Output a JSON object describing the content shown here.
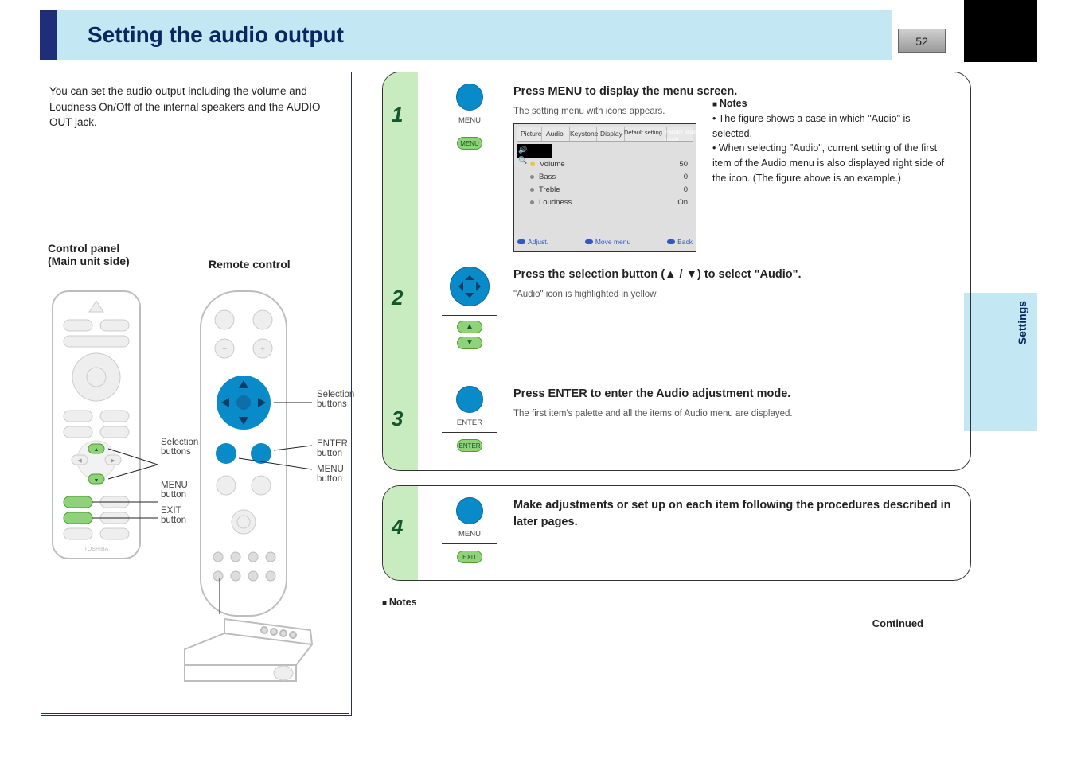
{
  "page": {
    "number": "52",
    "title": "Setting the audio output",
    "side_tab": "Settings"
  },
  "intro": "You can set the audio output including the volume and Loudness On/Off of the internal speakers and the AUDIO OUT jack.",
  "remote": {
    "title_left": "Control panel\n(Main unit side)",
    "title_right": "Remote control",
    "callouts": {
      "selection": "Selection\nbuttons",
      "menu_cp": "MENU\nbutton",
      "exit_cp": "EXIT\nbutton",
      "selection_rc": "Selection\nbuttons",
      "enter_rc": "ENTER\nbutton",
      "menu_rc": "MENU\nbutton"
    }
  },
  "icons": {
    "menu": "MENU",
    "enter": "ENTER",
    "exit": "EXIT"
  },
  "steps": [
    {
      "n": "1",
      "text": "Press MENU to display the menu screen.",
      "sub": "The setting menu with icons appears.",
      "icon_label_top": "MENU",
      "icon_label_bot": "MENU"
    },
    {
      "n": "2",
      "text_pre": "Press the selection button (",
      "text_mid": " / ",
      "text_post": ") to select \"Audio\".",
      "sub": "\"Audio\" icon is highlighted in yellow."
    },
    {
      "n": "3",
      "text": "Press ENTER to enter the Audio adjustment mode.",
      "sub": "The first item's palette and all the items of Audio menu are displayed.",
      "icon_label_top": "ENTER",
      "icon_label_bot": "ENTER"
    },
    {
      "n": "4",
      "text": "Make adjustments or set up on each item following the procedures described in later pages.",
      "icon_label_top": "MENU",
      "icon_label_bot": "EXIT"
    }
  ],
  "osd": {
    "tabs": [
      "Picture",
      "Audio",
      "Keystone",
      "Display",
      "Default setting",
      "Factory reset mode"
    ],
    "active_tab_index": 1,
    "rows": [
      {
        "dot": "y",
        "label": "Volume",
        "value": "50"
      },
      {
        "dot": "g",
        "label": "Bass",
        "value": "0"
      },
      {
        "dot": "g",
        "label": "Treble",
        "value": "0"
      },
      {
        "dot": "g",
        "label": "Loudness",
        "value": "On"
      }
    ],
    "footer": {
      "left": "Adjust.",
      "mid": "Move menu",
      "right": "Back"
    }
  },
  "notes": {
    "title": "Notes",
    "items": [
      "The figure shows a case in which \"Audio\" is selected.",
      "When selecting \"Audio\", current setting of the first item of the Audio menu is also displayed right side of the icon. (The figure above is an example.)"
    ]
  },
  "continued": "Continued"
}
